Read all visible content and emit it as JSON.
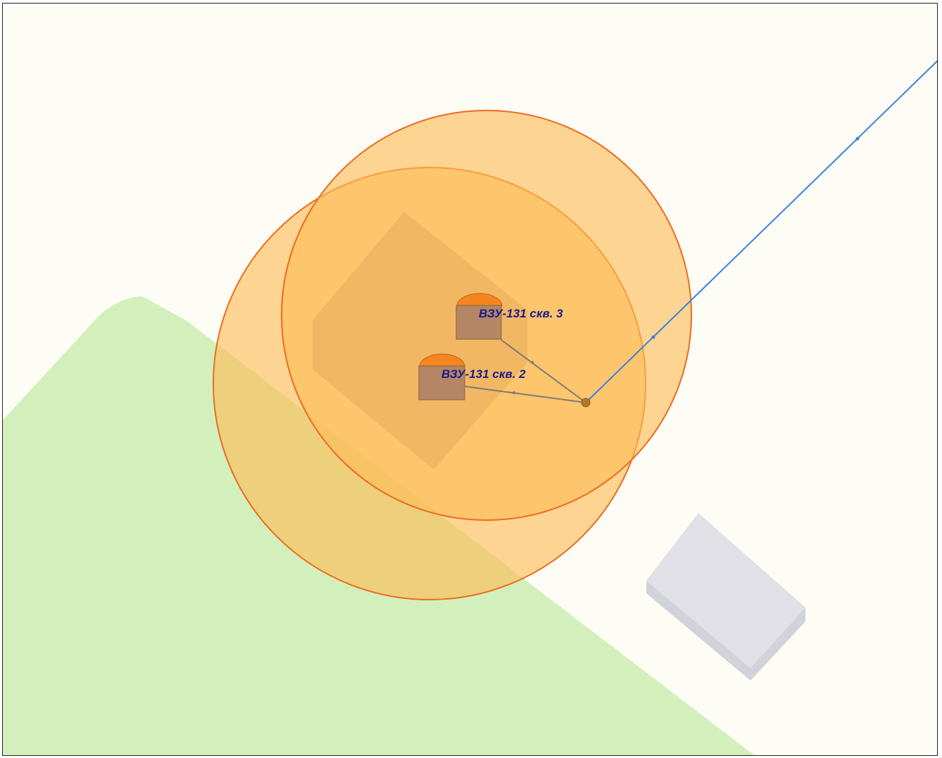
{
  "map": {
    "colors": {
      "background": "#fdfdf5",
      "green_area": "#d3f0bc",
      "building": "#e0e0e6",
      "building_shadow": "#d2d2da",
      "zone_fill": "#fdbb55",
      "zone_stroke": "#ee6a1f",
      "well_body": "#b48664",
      "well_cap": "#f5861f",
      "connector": "#7a7a7a",
      "pipeline": "#3d7fe0",
      "junction": "#b07a2a",
      "label": "#1a1a8c"
    },
    "wells": [
      {
        "label": "ВЗУ-131 скв. 3",
        "icon": "well-icon"
      },
      {
        "label": "ВЗУ-131 скв. 2",
        "icon": "well-icon"
      }
    ],
    "protection_zones": [
      {
        "well": "ВЗУ-131 скв. 3",
        "shape": "circle"
      },
      {
        "well": "ВЗУ-131 скв. 2",
        "shape": "circle"
      }
    ],
    "features": [
      "green-area",
      "building",
      "pipeline",
      "junction-node"
    ]
  }
}
